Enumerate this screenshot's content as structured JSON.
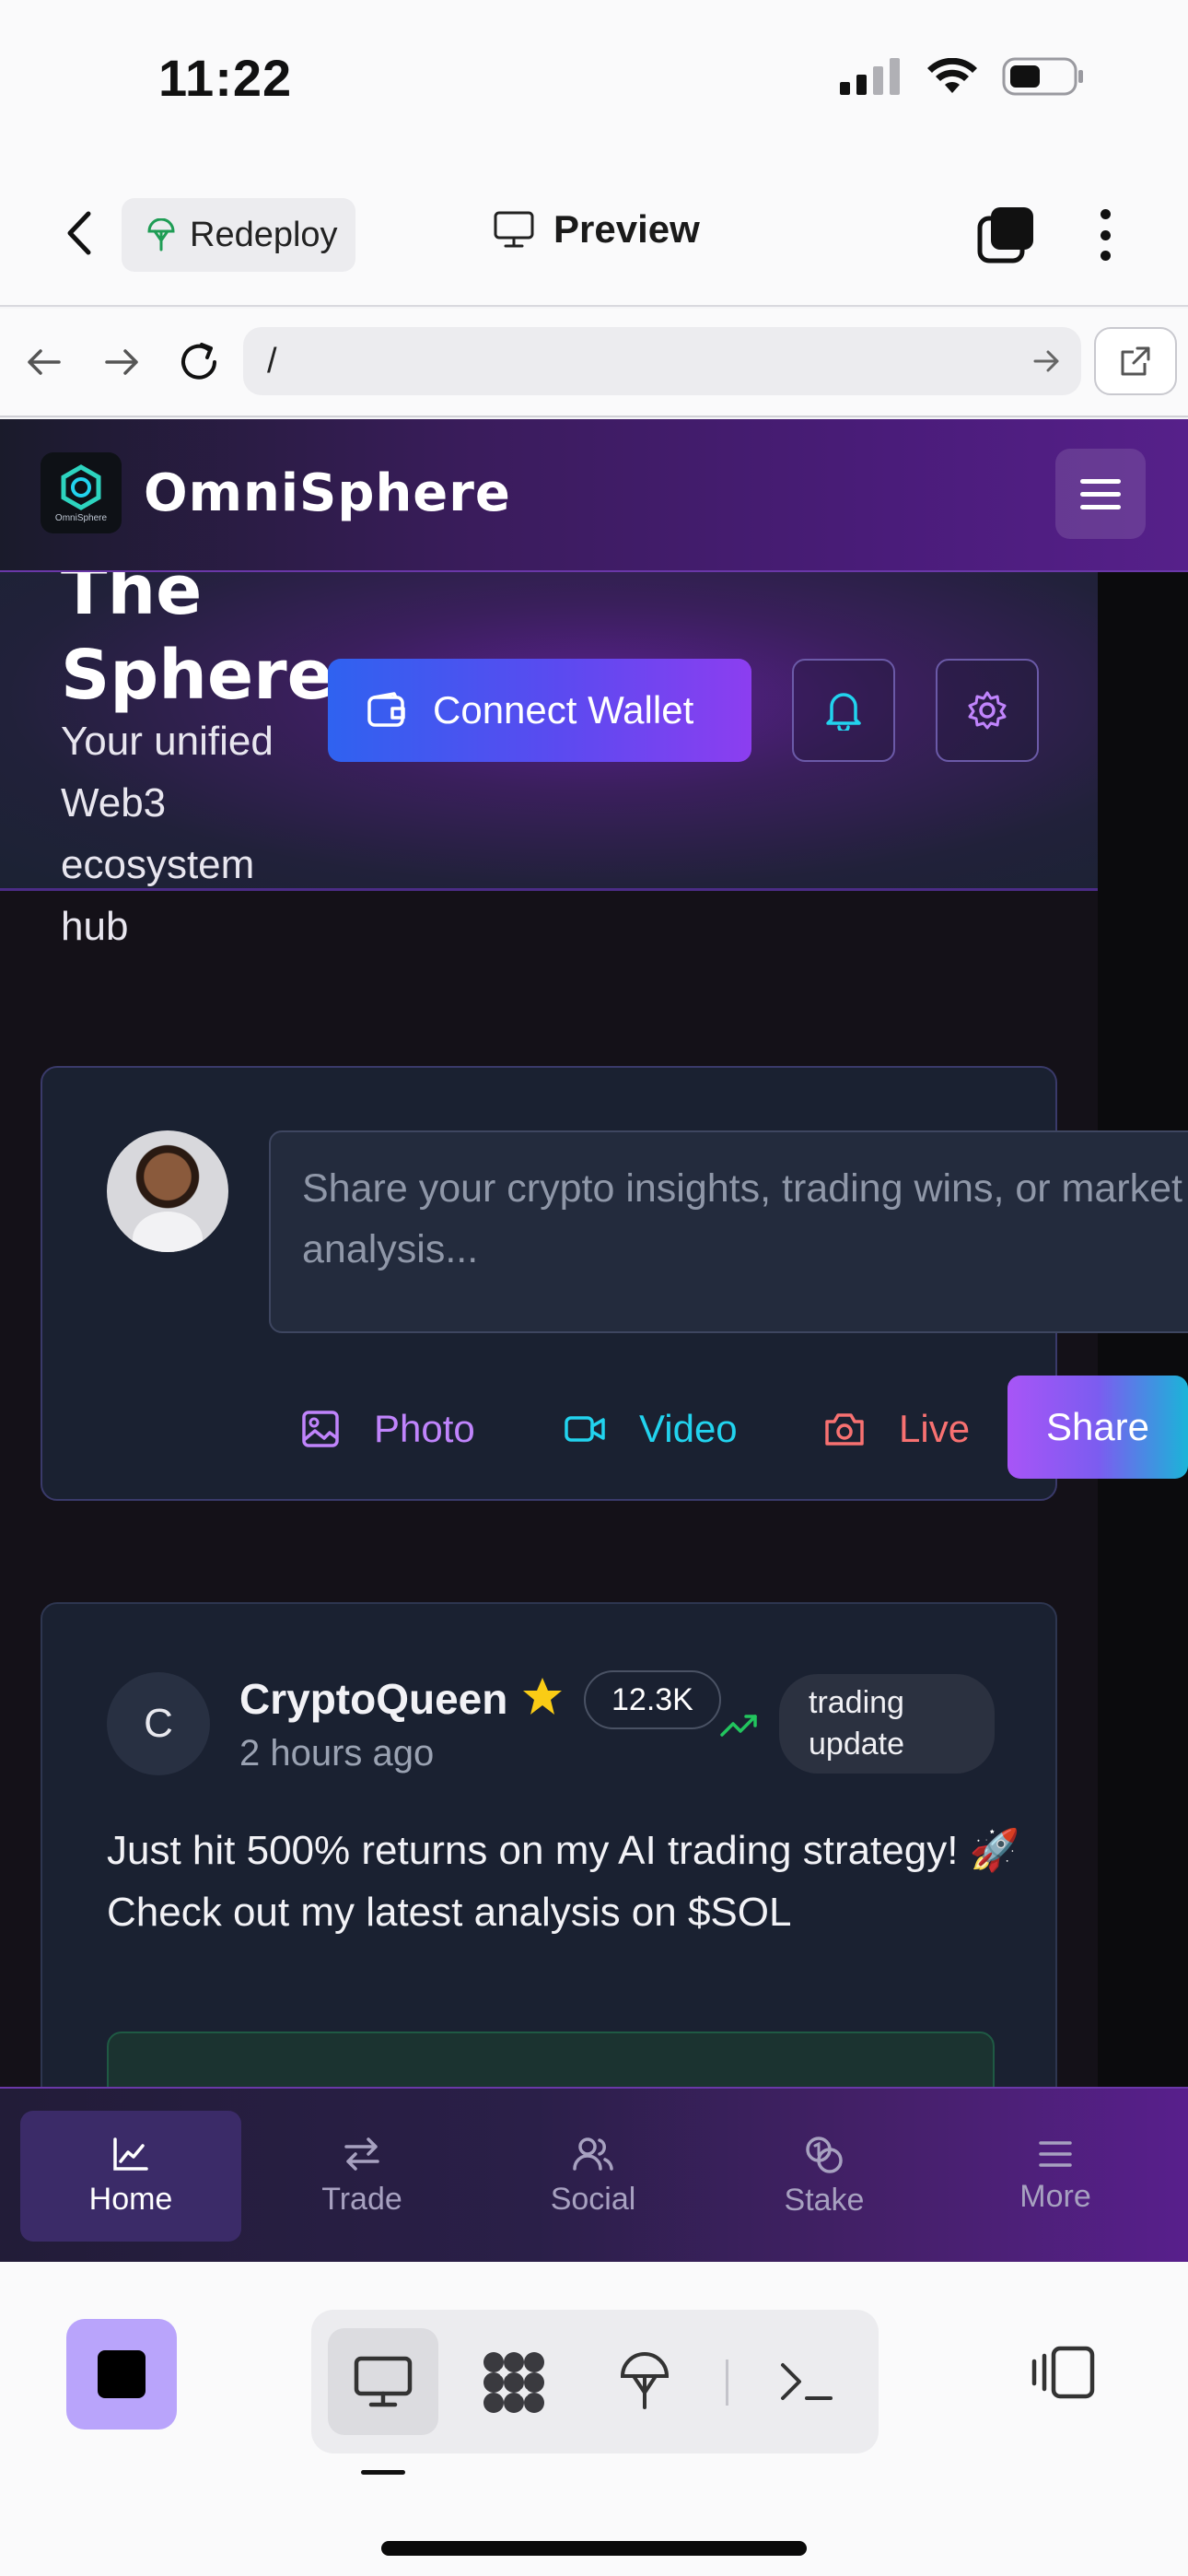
{
  "status_bar": {
    "time": "11:22"
  },
  "app_bar": {
    "redeploy_label": "Redeploy",
    "preview_label": "Preview"
  },
  "url_bar": {
    "url": "/"
  },
  "site": {
    "brand": "OmniSphere",
    "logo_caption": "OmniSphere",
    "hero": {
      "title_line1": "The",
      "title_line2": "Sphere",
      "subtitle": "Your unified Web3 ecosystem hub",
      "connect_label": "Connect Wallet"
    },
    "composer": {
      "placeholder": "Share your crypto insights, trading wins, or market analysis...",
      "photo_label": "Photo",
      "video_label": "Video",
      "live_label": "Live",
      "share_label": "Share"
    },
    "post": {
      "avatar_initial": "C",
      "author": "CryptoQueen",
      "followers": "12.3K",
      "tag": "trading update",
      "time": "2 hours ago",
      "body": "Just hit 500% returns on my AI trading strategy! 🚀 Check out my latest analysis on $SOL"
    },
    "bottom_nav": [
      {
        "label": "Home",
        "icon": "chart-line-icon",
        "active": true
      },
      {
        "label": "Trade",
        "icon": "arrows-exchange-icon"
      },
      {
        "label": "Social",
        "icon": "users-icon"
      },
      {
        "label": "Stake",
        "icon": "coins-icon"
      },
      {
        "label": "More",
        "icon": "menu-icon"
      }
    ]
  },
  "colors": {
    "accent_purple": "#8c3ef0",
    "accent_blue": "#2f62f0",
    "photo": "#c084fc",
    "video": "#22d3ee",
    "live": "#f87171"
  }
}
